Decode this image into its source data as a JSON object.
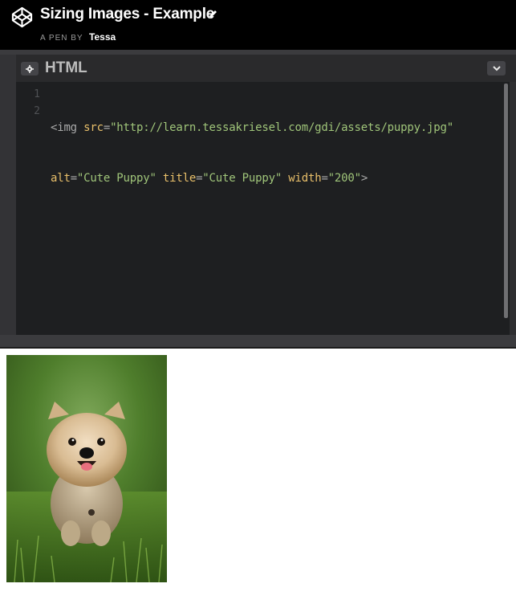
{
  "header": {
    "title": "Sizing Images - Example",
    "byline_prefix": "A PEN BY",
    "author": "Tessa",
    "logo_icon": "codepen-logo-icon",
    "edit_icon": "pencil-icon"
  },
  "editor": {
    "label": "HTML",
    "settings_icon": "gear-icon",
    "collapse_icon": "chevron-down-icon",
    "line_numbers": [
      "1",
      "2"
    ],
    "code": {
      "l1_open": "<img ",
      "l1_attr": "src",
      "l1_eq": "=",
      "l1_val": "\"http://learn.tessakriesel.com/gdi/assets/puppy.jpg\"",
      "l2_attr1": "alt",
      "l2_eq1": "=",
      "l2_val1": "\"Cute Puppy\"",
      "l2_sp1": " ",
      "l2_attr2": "title",
      "l2_eq2": "=",
      "l2_val2": "\"Cute Puppy\"",
      "l2_sp2": " ",
      "l2_attr3": "width",
      "l2_eq3": "=",
      "l2_val3": "\"200\"",
      "l2_close": ">"
    }
  },
  "preview": {
    "image_alt": "Cute Puppy",
    "image_title": "Cute Puppy"
  },
  "colors": {
    "header_bg": "#000000",
    "editor_bg": "#1e1f21",
    "attr": "#e8bf6a",
    "string": "#9fc479",
    "tag": "#a9a9a9"
  }
}
